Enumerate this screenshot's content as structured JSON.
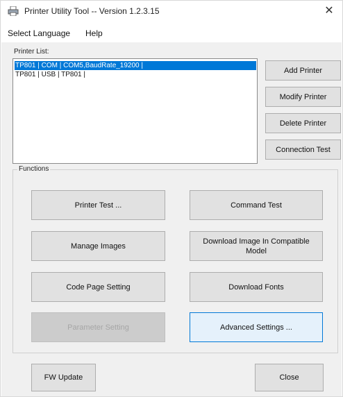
{
  "window": {
    "title": "Printer Utility Tool -- Version 1.2.3.15",
    "close_glyph": "✕",
    "app_icon": "printer-icon"
  },
  "menu": {
    "items": [
      "Select Language",
      "Help"
    ]
  },
  "printer_list": {
    "label": "Printer List:",
    "rows": [
      "TP801 | COM | COM5,BaudRate_19200 |",
      "TP801 | USB | TP801 |"
    ],
    "selected_index": 0
  },
  "side_buttons": {
    "add": "Add Printer",
    "modify": "Modify Printer",
    "delete": "Delete Printer",
    "connection_test": "Connection Test"
  },
  "functions": {
    "title": "Functions",
    "printer_test": "Printer Test ...",
    "command_test": "Command Test",
    "manage_images": "Manage Images",
    "download_image": "Download Image In Compatible Model",
    "code_page": "Code Page Setting",
    "download_fonts": "Download Fonts",
    "parameter_setting": "Parameter Setting",
    "advanced_settings": "Advanced Settings ..."
  },
  "bottom": {
    "fw_update": "FW Update",
    "close": "Close"
  },
  "colors": {
    "selection": "#0078d7",
    "button_face": "#e1e1e1",
    "client_bg": "#f0f0f0"
  }
}
